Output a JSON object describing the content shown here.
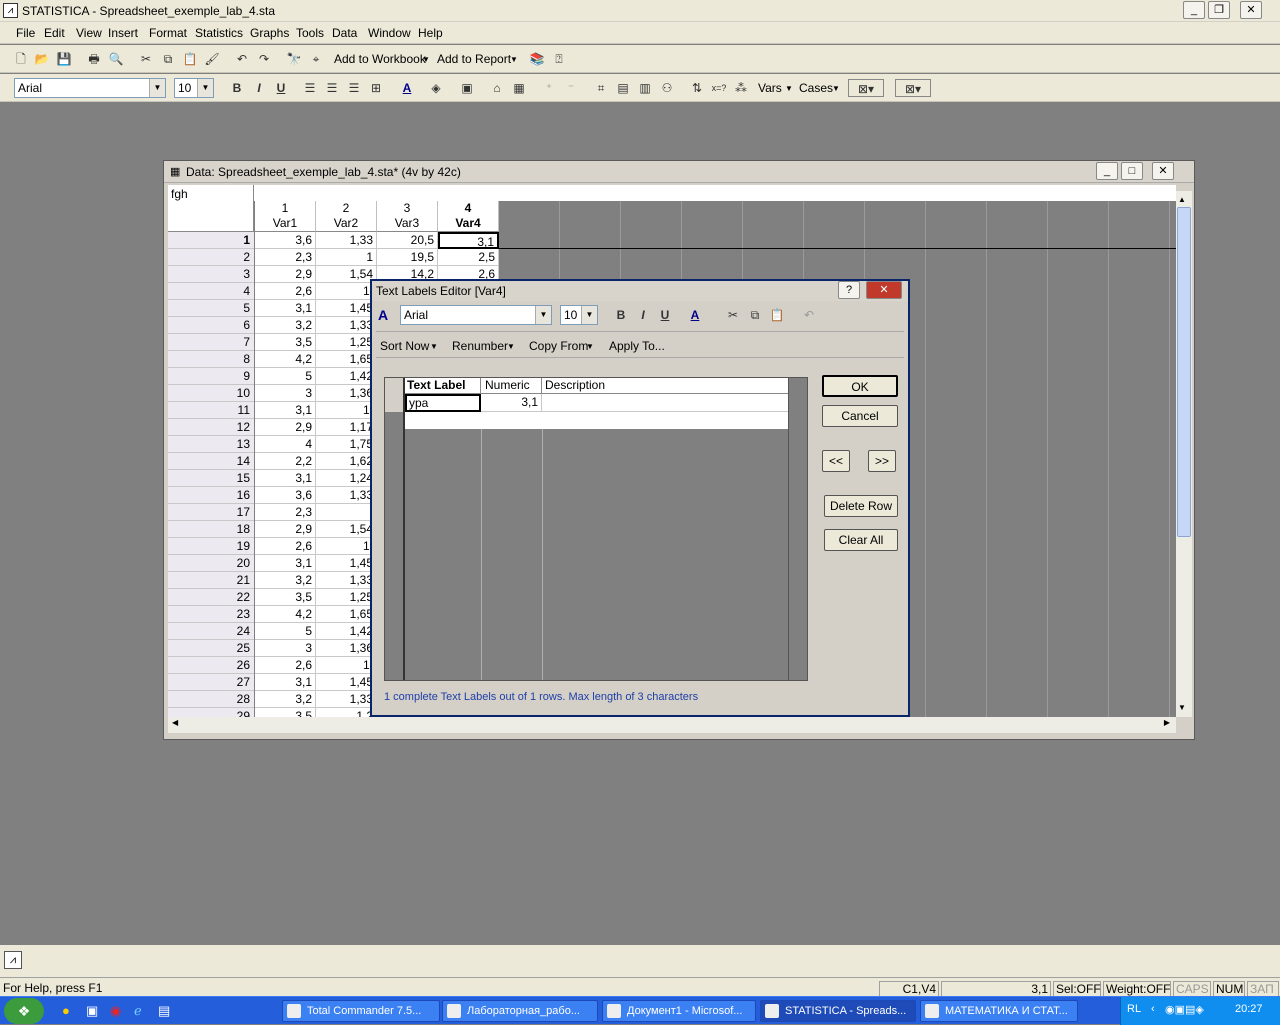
{
  "app": {
    "title": "STATISTICA - Spreadsheet_exemple_lab_4.sta",
    "menu": [
      "File",
      "Edit",
      "View",
      "Insert",
      "Format",
      "Statistics",
      "Graphs",
      "Tools",
      "Data",
      "Window",
      "Help"
    ],
    "toolbar": {
      "add_workbook": "Add to Workbook",
      "add_report": "Add to Report",
      "font": "Arial",
      "size": "10",
      "vars": "Vars",
      "cases": "Cases"
    }
  },
  "datawin": {
    "title": "Data: Spreadsheet_exemple_lab_4.sta* (4v by 42c)",
    "header_text": "fgh",
    "columns": [
      {
        "num": "1",
        "name": "Var1"
      },
      {
        "num": "2",
        "name": "Var2"
      },
      {
        "num": "3",
        "name": "Var3"
      },
      {
        "num": "4",
        "name": "Var4"
      }
    ],
    "rows": [
      {
        "n": "1",
        "v": [
          "3,6",
          "1,33",
          "20,5",
          "3,1"
        ]
      },
      {
        "n": "2",
        "v": [
          "2,3",
          "1",
          "19,5",
          "2,5"
        ]
      },
      {
        "n": "3",
        "v": [
          "2,9",
          "1,54",
          "14,2",
          "2,6"
        ]
      },
      {
        "n": "4",
        "v": [
          "2,6",
          "1,",
          "",
          ""
        ]
      },
      {
        "n": "5",
        "v": [
          "3,1",
          "1,45",
          "",
          ""
        ]
      },
      {
        "n": "6",
        "v": [
          "3,2",
          "1,33",
          "",
          ""
        ]
      },
      {
        "n": "7",
        "v": [
          "3,5",
          "1,25",
          "",
          ""
        ]
      },
      {
        "n": "8",
        "v": [
          "4,2",
          "1,65",
          "",
          ""
        ]
      },
      {
        "n": "9",
        "v": [
          "5",
          "1,42",
          "",
          ""
        ]
      },
      {
        "n": "10",
        "v": [
          "3",
          "1,36",
          "",
          ""
        ]
      },
      {
        "n": "11",
        "v": [
          "3,1",
          "1,",
          "",
          ""
        ]
      },
      {
        "n": "12",
        "v": [
          "2,9",
          "1,17",
          "",
          ""
        ]
      },
      {
        "n": "13",
        "v": [
          "4",
          "1,75",
          "",
          ""
        ]
      },
      {
        "n": "14",
        "v": [
          "2,2",
          "1,62",
          "",
          ""
        ]
      },
      {
        "n": "15",
        "v": [
          "3,1",
          "1,24",
          "",
          ""
        ]
      },
      {
        "n": "16",
        "v": [
          "3,6",
          "1,33",
          "",
          ""
        ]
      },
      {
        "n": "17",
        "v": [
          "2,3",
          "",
          "",
          ""
        ]
      },
      {
        "n": "18",
        "v": [
          "2,9",
          "1,54",
          "",
          ""
        ]
      },
      {
        "n": "19",
        "v": [
          "2,6",
          "1,",
          "",
          ""
        ]
      },
      {
        "n": "20",
        "v": [
          "3,1",
          "1,45",
          "",
          ""
        ]
      },
      {
        "n": "21",
        "v": [
          "3,2",
          "1,33",
          "",
          ""
        ]
      },
      {
        "n": "22",
        "v": [
          "3,5",
          "1,25",
          "",
          ""
        ]
      },
      {
        "n": "23",
        "v": [
          "4,2",
          "1,65",
          "",
          ""
        ]
      },
      {
        "n": "24",
        "v": [
          "5",
          "1,42",
          "",
          ""
        ]
      },
      {
        "n": "25",
        "v": [
          "3",
          "1,36",
          "",
          ""
        ]
      },
      {
        "n": "26",
        "v": [
          "2,6",
          "1,",
          "",
          ""
        ]
      },
      {
        "n": "27",
        "v": [
          "3,1",
          "1,45",
          "",
          ""
        ]
      },
      {
        "n": "28",
        "v": [
          "3,2",
          "1,33",
          "",
          ""
        ]
      },
      {
        "n": "29",
        "v": [
          "3,5",
          "1,2",
          "",
          ""
        ]
      }
    ]
  },
  "dialog": {
    "title": "Text Labels Editor [Var4]",
    "font": "Arial",
    "size": "10",
    "menu": {
      "sort": "Sort Now",
      "renumber": "Renumber",
      "copy": "Copy From",
      "apply": "Apply To..."
    },
    "grid_headers": {
      "label": "Text Label",
      "numeric": "Numeric",
      "desc": "Description"
    },
    "row1": {
      "label": "ypa",
      "numeric": "3,1",
      "desc": ""
    },
    "buttons": {
      "ok": "OK",
      "cancel": "Cancel",
      "prev": "<<",
      "next": ">>",
      "delete": "Delete Row",
      "clear": "Clear All"
    },
    "status": "1 complete Text Labels out of 1 rows. Max length of 3 characters"
  },
  "statusbar": {
    "help": "For Help, press F1",
    "cell": "C1,V4",
    "value": "3,1",
    "sel": "Sel:OFF",
    "weight": "Weight:OFF",
    "caps": "CAPS",
    "num": "NUM",
    "ovr": "ЗАП"
  },
  "taskbar": {
    "tasks": [
      "Total Commander 7.5...",
      "Лабораторная_рабо...",
      "Документ1 - Microsof...",
      "STATISTICA - Spreads...",
      "МАТЕМАТИКА И СТАТ..."
    ],
    "lang": "RL",
    "clock": "20:27"
  }
}
